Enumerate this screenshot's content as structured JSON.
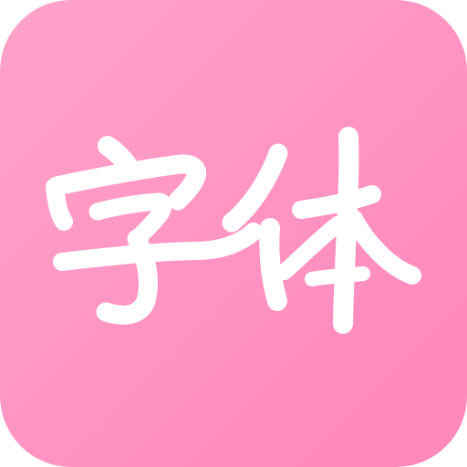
{
  "app_icon": {
    "logo_text": "字体",
    "colors": {
      "background_start": "#ffa3c9",
      "background_end": "#ff86bb",
      "glyph": "#ffffff"
    }
  }
}
